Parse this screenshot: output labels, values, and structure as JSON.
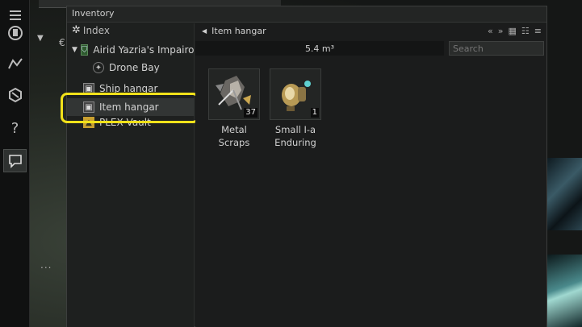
{
  "window": {
    "title": "Inventory"
  },
  "tree": {
    "header": "Index",
    "rows": [
      {
        "label": "Airid Yazria's Impairor",
        "icon": "ship-icon",
        "expanded": true
      },
      {
        "label": "Drone Bay",
        "icon": "drone-icon"
      },
      {
        "label": "Ship hangar",
        "icon": "hangar-icon"
      },
      {
        "label": "Item hangar",
        "icon": "hangar-icon",
        "selected": true
      },
      {
        "label": "PLEX Vault",
        "icon": "plex-icon"
      }
    ]
  },
  "content": {
    "breadcrumb": "Item hangar",
    "volume": "5.4 m³",
    "search_placeholder": "Search",
    "items": [
      {
        "name_line1": "Metal",
        "name_line2": "Scraps",
        "quantity": "37",
        "icon": "metal-scraps-icon"
      },
      {
        "name_line1": "Small I-a",
        "name_line2": "Enduring",
        "quantity": "1",
        "icon": "shield-booster-icon"
      }
    ]
  },
  "neocom": {
    "dots": "..."
  },
  "colors": {
    "highlight": "#f2e21a",
    "selected_row": "#323534"
  }
}
